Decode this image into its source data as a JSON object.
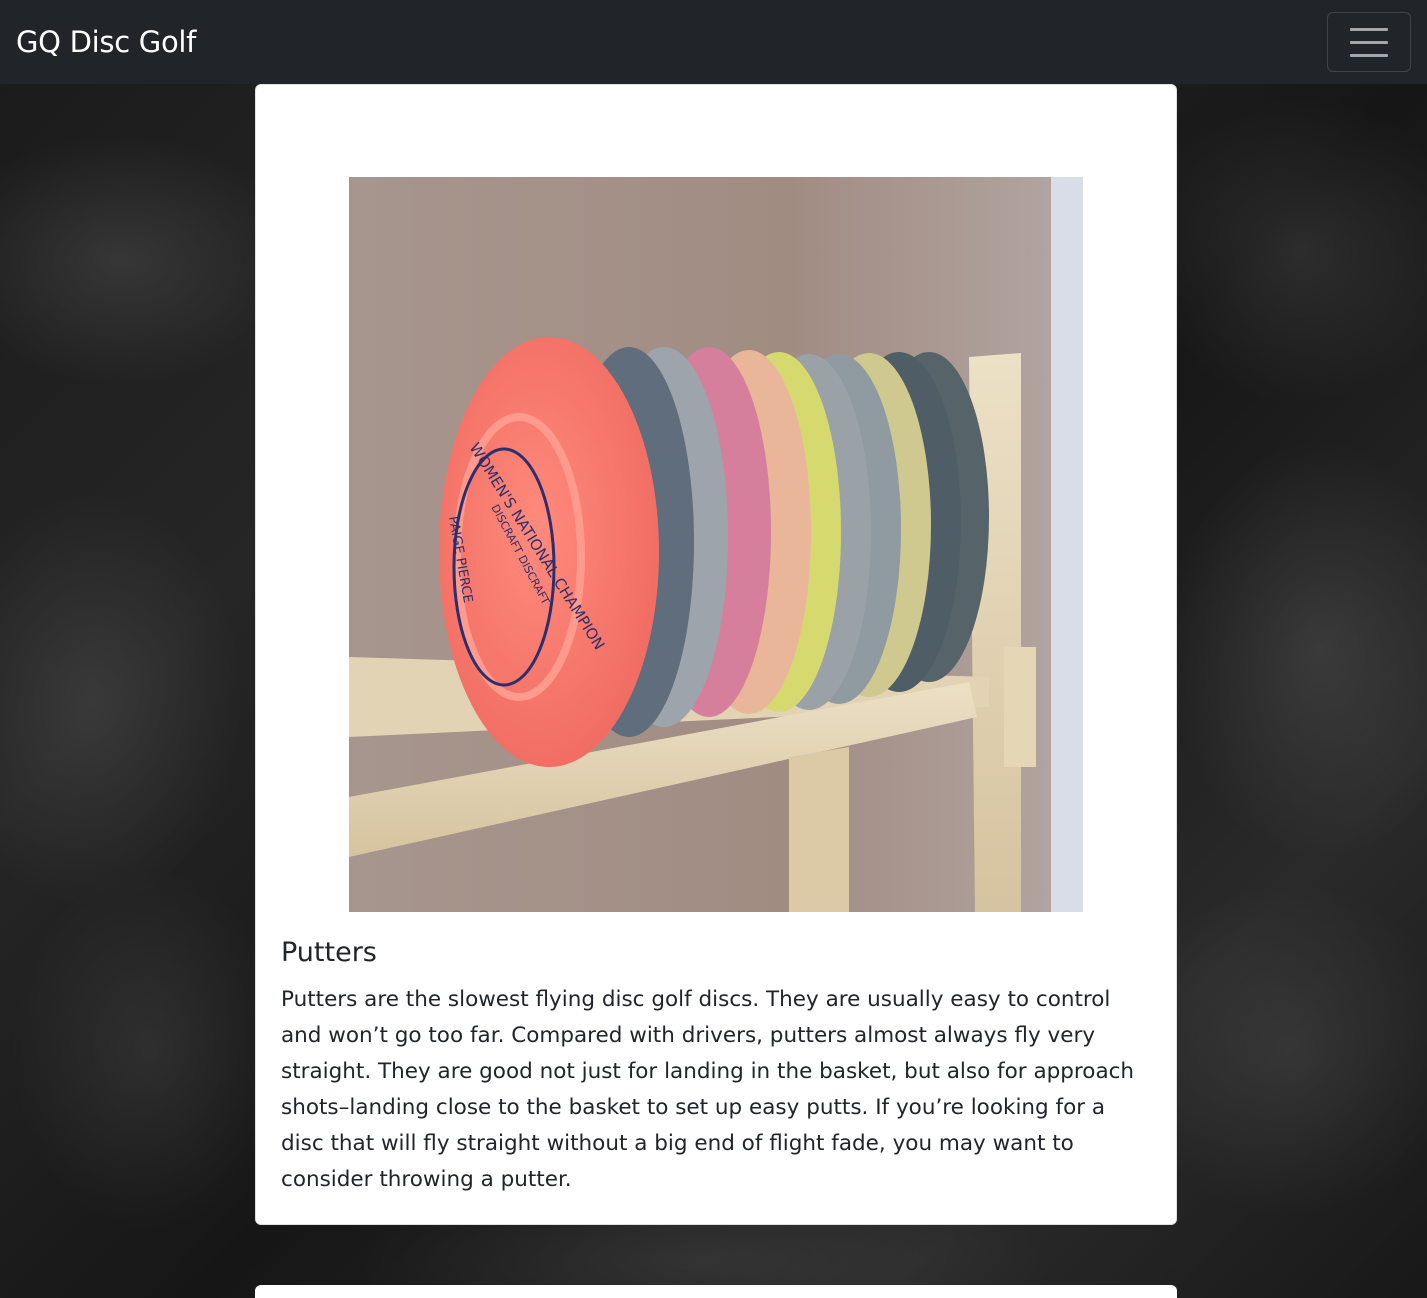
{
  "navbar": {
    "brand": "GQ Disc Golf",
    "toggler_icon": "hamburger-menu-icon"
  },
  "article": {
    "image_alt": "Putters",
    "title": "Putters",
    "text": "Putters are the slowest flying disc golf discs. They are usually easy to control and won’t go too far. Compared with drivers, putters almost always fly very straight. They are good not just for landing in the basket, but also for approach shots–landing close to the basket to set up easy putts. If you’re looking for a disc that will fly straight without a big end of flight fade, you may want to consider throwing a putter."
  },
  "photo_disc_print": {
    "ring": "WOMEN'S NATIONAL CHAMPION",
    "inner": "DISCRAFT DISCRAFT",
    "name": "PAIGE PIERCE"
  },
  "colors": {
    "navbar": "#212529",
    "card": "#ffffff",
    "text": "#212529"
  }
}
